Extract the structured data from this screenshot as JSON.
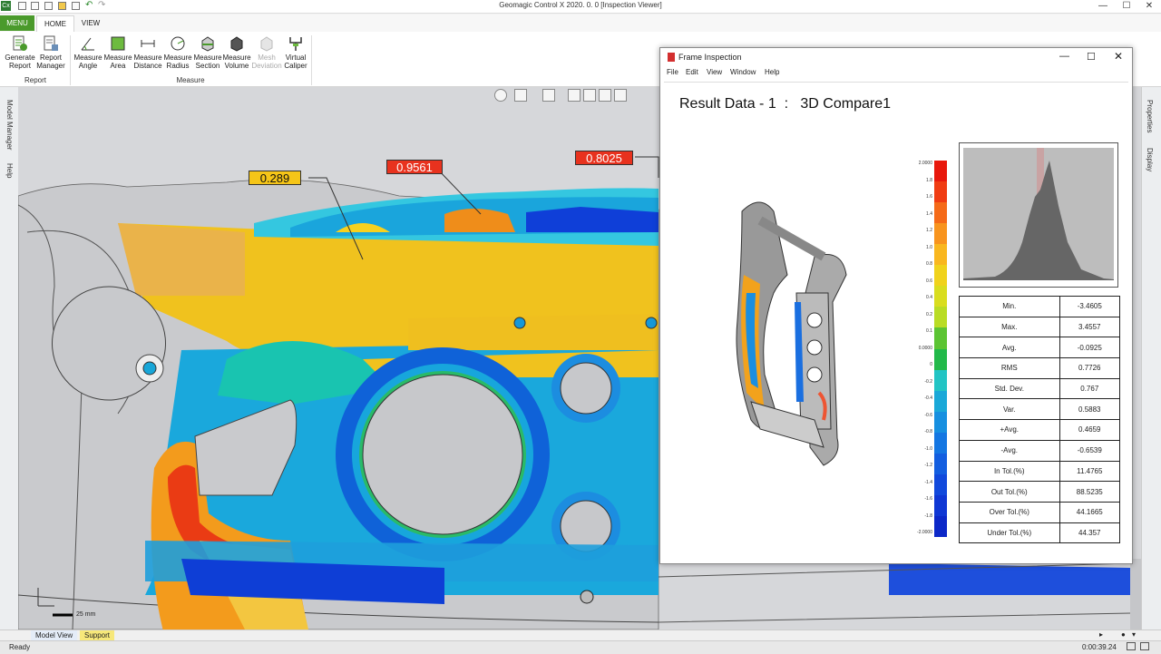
{
  "window": {
    "title": "Geomagic Control X 2020. 0. 0   [Inspection Viewer]",
    "controls": [
      "—",
      "☐",
      "✕"
    ]
  },
  "ribbon": {
    "menu_label": "MENU",
    "tabs": [
      {
        "label": "HOME"
      },
      {
        "label": "VIEW"
      }
    ],
    "buttons": [
      {
        "label": "Generate\nReport",
        "icon": "report-icon",
        "enabled": true
      },
      {
        "label": "Report\nManager",
        "icon": "report-manager-icon",
        "enabled": true
      },
      {
        "label": "Measure\nAngle",
        "icon": "angle-icon",
        "enabled": true
      },
      {
        "label": "Measure\nArea",
        "icon": "area-icon",
        "enabled": true
      },
      {
        "label": "Measure\nDistance",
        "icon": "distance-icon",
        "enabled": true
      },
      {
        "label": "Measure\nRadius",
        "icon": "radius-icon",
        "enabled": true
      },
      {
        "label": "Measure\nSection",
        "icon": "section-icon",
        "enabled": true
      },
      {
        "label": "Measure\nVolume",
        "icon": "volume-icon",
        "enabled": true
      },
      {
        "label": "Mesh\nDeviation",
        "icon": "mesh-deviation-icon",
        "enabled": false
      },
      {
        "label": "Virtual\nCaliper",
        "icon": "caliper-icon",
        "enabled": true
      }
    ],
    "groups": [
      {
        "label": "Report"
      },
      {
        "label": "Measure"
      }
    ]
  },
  "side_panels": {
    "left": [
      "Model Manager",
      "Help"
    ],
    "right": [
      "Properties",
      "Display"
    ]
  },
  "viewport": {
    "callouts": [
      {
        "value": "0.289",
        "color": "#f5c518"
      },
      {
        "value": "0.9561",
        "color": "#e8321e"
      },
      {
        "value": "0.8025",
        "color": "#e8321e"
      }
    ],
    "scale_label": "25 mm"
  },
  "bottom_tabs": [
    {
      "label": "Model View"
    },
    {
      "label": "Support"
    }
  ],
  "status": {
    "left": "Ready",
    "time": "0:00:39.24"
  },
  "frame_inspection": {
    "title": "Frame Inspection",
    "menu": [
      {
        "label": "File"
      },
      {
        "label": "Edit"
      },
      {
        "label": "View"
      },
      {
        "label": "Window"
      },
      {
        "label": "Help"
      }
    ],
    "result_title": "Result Data - 1  :   3D Compare1",
    "color_scale": {
      "labels": [
        "2.0000",
        "1.8",
        "1.6",
        "1.4",
        "1.2",
        "1.0",
        "0.8",
        "0.6",
        "0.4",
        "0.2",
        "0.1",
        "0.0000",
        "0",
        "-0.2",
        "-0.4",
        "-0.6",
        "-0.8",
        "-1.0",
        "-1.2",
        "-1.4",
        "-1.6",
        "-1.8",
        "-2.0000"
      ],
      "colors": [
        "#e8180c",
        "#f03c12",
        "#f56a18",
        "#f8941e",
        "#f9b71f",
        "#f0d21c",
        "#d9dd1f",
        "#b9dc25",
        "#5cc433",
        "#22b94a",
        "#22c4c4",
        "#1aa8d8",
        "#168fe0",
        "#1476e2",
        "#135ee0",
        "#1149dc",
        "#0f37d4",
        "#0c28c8"
      ]
    },
    "stats": [
      {
        "label": "Min.",
        "value": "-3.4605"
      },
      {
        "label": "Max.",
        "value": "3.4557"
      },
      {
        "label": "Avg.",
        "value": "-0.0925"
      },
      {
        "label": "RMS",
        "value": "0.7726"
      },
      {
        "label": "Std. Dev.",
        "value": "0.767"
      },
      {
        "label": "Var.",
        "value": "0.5883"
      },
      {
        "label": "+Avg.",
        "value": "0.4659"
      },
      {
        "label": "-Avg.",
        "value": "-0.6539"
      },
      {
        "label": "In Tol.(%)",
        "value": "11.4765"
      },
      {
        "label": "Out Tol.(%)",
        "value": "88.5235"
      },
      {
        "label": "Over Tol.(%)",
        "value": "44.1665"
      },
      {
        "label": "Under Tol.(%)",
        "value": "44.357"
      }
    ]
  }
}
